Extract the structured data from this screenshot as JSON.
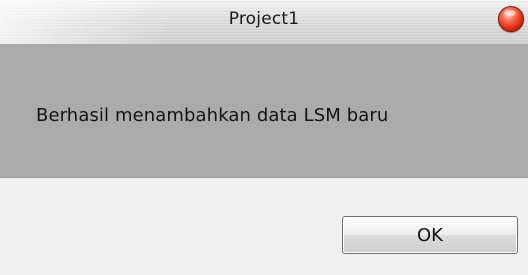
{
  "window": {
    "title": "Project1",
    "close_icon": "close-icon",
    "close_color": "#d92a12"
  },
  "message": {
    "text": "Berhasil menambahkan data LSM baru"
  },
  "buttons": {
    "ok_label": "OK"
  }
}
